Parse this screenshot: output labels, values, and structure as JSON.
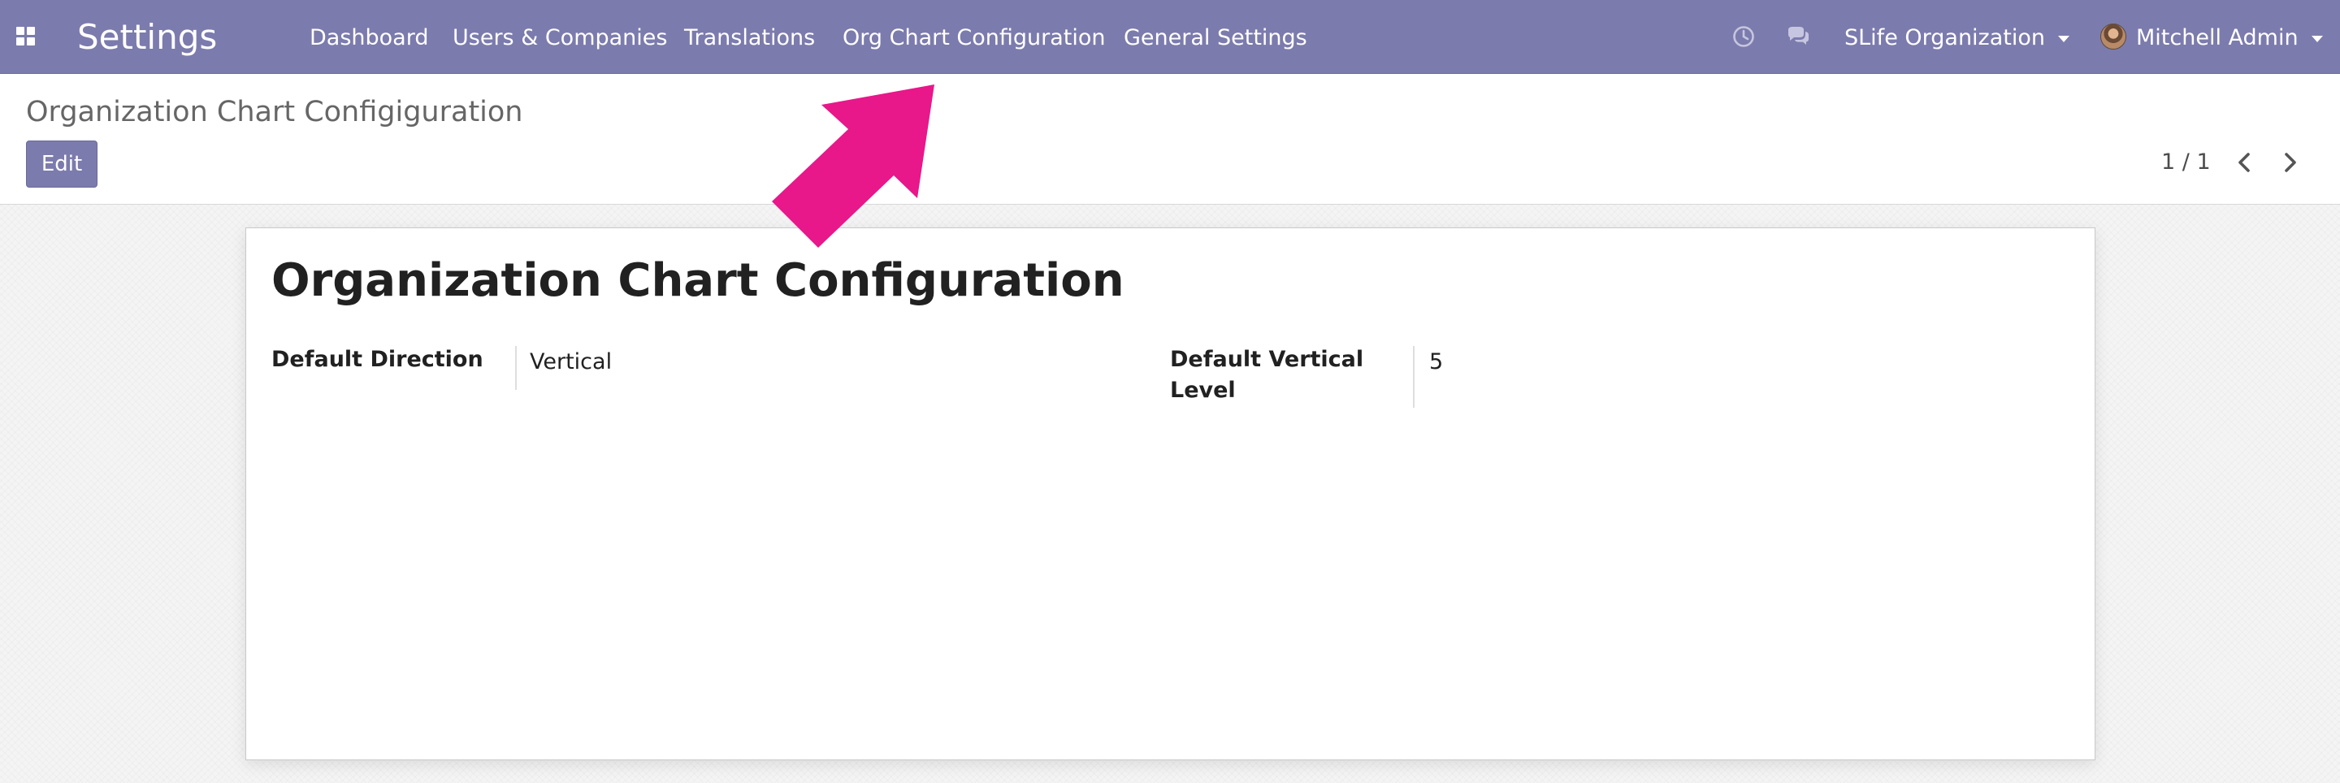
{
  "app": {
    "title": "Settings"
  },
  "nav": {
    "items": [
      {
        "label": "Dashboard"
      },
      {
        "label": "Users & Companies"
      },
      {
        "label": "Translations"
      },
      {
        "label": "Org Chart Configuration"
      },
      {
        "label": "General Settings"
      }
    ]
  },
  "systray": {
    "activity_icon": "clock-icon",
    "messaging_icon": "chat-bubbles-icon",
    "company": "SLife Organization",
    "user": "Mitchell Admin"
  },
  "control_panel": {
    "breadcrumb": "Organization Chart Configiguration",
    "edit_label": "Edit",
    "pager": "1 / 1"
  },
  "form": {
    "title": "Organization Chart Configuration",
    "fields": [
      {
        "label": "Default Direction",
        "value": "Vertical"
      },
      {
        "label": "Default Vertical Level",
        "value": "5"
      }
    ]
  },
  "colors": {
    "navbar": "#7c7bad",
    "annotation_arrow": "#e8178a"
  }
}
